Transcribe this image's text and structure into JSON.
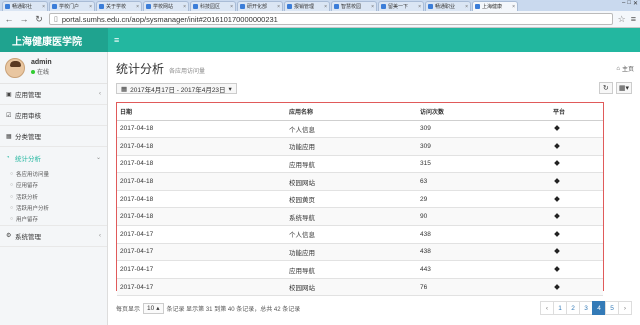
{
  "browser": {
    "tabs": [
      {
        "label": "畅通职社"
      },
      {
        "label": "学校门户"
      },
      {
        "label": "关于学校"
      },
      {
        "label": "学校网站"
      },
      {
        "label": "科技园区"
      },
      {
        "label": "研开化部"
      },
      {
        "label": "报销管理"
      },
      {
        "label": "智慧校园"
      },
      {
        "label": "留美一下"
      },
      {
        "label": "畅通职业"
      },
      {
        "label": "上海健康"
      }
    ],
    "url": "portal.sumhs.edu.cn/aop/sysmanager/init#201610170000000231"
  },
  "header": {
    "logo": "上海健康医学院",
    "menu_icon": "≡"
  },
  "user": {
    "name": "admin",
    "status": "在线"
  },
  "sidebar": {
    "items": [
      {
        "label": "应用管理",
        "icon": "▣"
      },
      {
        "label": "应用审核",
        "icon": "☑"
      },
      {
        "label": "分类管理",
        "icon": "▦"
      },
      {
        "label": "统计分析",
        "icon": "◔"
      },
      {
        "label": "系统管理",
        "icon": "⚙"
      }
    ],
    "subitems": [
      {
        "label": "各应用访问量"
      },
      {
        "label": "应用留存"
      },
      {
        "label": "活跃分析"
      },
      {
        "label": "活跃用户分析"
      },
      {
        "label": "用户留存"
      }
    ]
  },
  "main": {
    "title": "统计分析",
    "subtitle": "各应用访问量",
    "breadcrumb": "主页",
    "date_range": "2017年4月17日 - 2017年4月23日",
    "columns": [
      "日期",
      "应用名称",
      "访问次数",
      "平台"
    ],
    "rows": [
      {
        "date": "2017-04-18",
        "app": "个人信息",
        "count": "309"
      },
      {
        "date": "2017-04-18",
        "app": "功能应用",
        "count": "309"
      },
      {
        "date": "2017-04-18",
        "app": "应用导航",
        "count": "315"
      },
      {
        "date": "2017-04-18",
        "app": "校园网站",
        "count": "63"
      },
      {
        "date": "2017-04-18",
        "app": "校园黄页",
        "count": "29"
      },
      {
        "date": "2017-04-18",
        "app": "系统导航",
        "count": "90"
      },
      {
        "date": "2017-04-17",
        "app": "个人信息",
        "count": "438"
      },
      {
        "date": "2017-04-17",
        "app": "功能应用",
        "count": "438"
      },
      {
        "date": "2017-04-17",
        "app": "应用导航",
        "count": "443"
      },
      {
        "date": "2017-04-17",
        "app": "校园网站",
        "count": "76"
      }
    ],
    "footer": {
      "per_page_label": "每页显示",
      "per_page_value": "10",
      "records_text": "条记录 显示第 31 到第 40 条记录，总共 42 条记录"
    },
    "pagination": [
      "‹",
      "1",
      "2",
      "3",
      "4",
      "5",
      "›"
    ],
    "active_page": "4"
  }
}
